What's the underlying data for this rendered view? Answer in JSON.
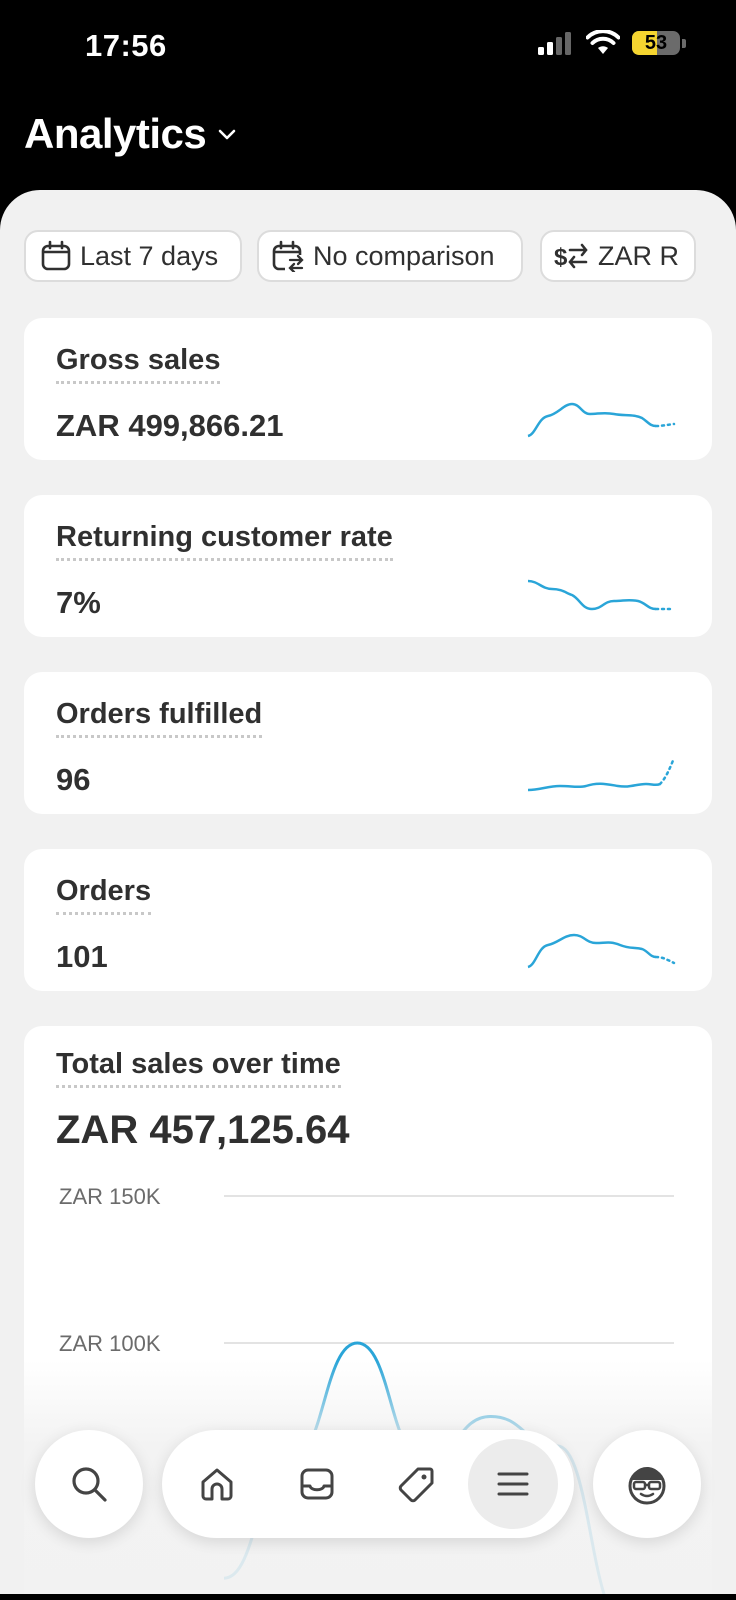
{
  "status_bar": {
    "time": "17:56",
    "battery": "53"
  },
  "header": {
    "title": "Analytics"
  },
  "filters": {
    "date_range": "Last 7 days",
    "comparison": "No comparison",
    "currency": "ZAR R"
  },
  "metrics": [
    {
      "title": "Gross sales",
      "value": "ZAR 499,866.21"
    },
    {
      "title": "Returning customer rate",
      "value": "7%"
    },
    {
      "title": "Orders fulfilled",
      "value": "96"
    },
    {
      "title": "Orders",
      "value": "101"
    }
  ],
  "sales_card": {
    "title": "Total sales over time",
    "value": "ZAR 457,125.64"
  },
  "chart_data": {
    "type": "line",
    "ylabel": "",
    "y_ticks": [
      "ZAR 150K",
      "ZAR 100K"
    ],
    "series": [
      {
        "values": [
          20000,
          60000,
          100000,
          60000,
          75000,
          65000,
          5000
        ]
      }
    ],
    "grid": true
  },
  "tab_bar": {
    "items": [
      "search-icon",
      "home-icon",
      "inbox-icon",
      "tag-icon",
      "menu-icon",
      "avatar-icon"
    ],
    "active": "menu-icon"
  },
  "colors": {
    "accent": "#2aa5d8",
    "background": "#f1f1f1",
    "card": "#ffffff"
  }
}
